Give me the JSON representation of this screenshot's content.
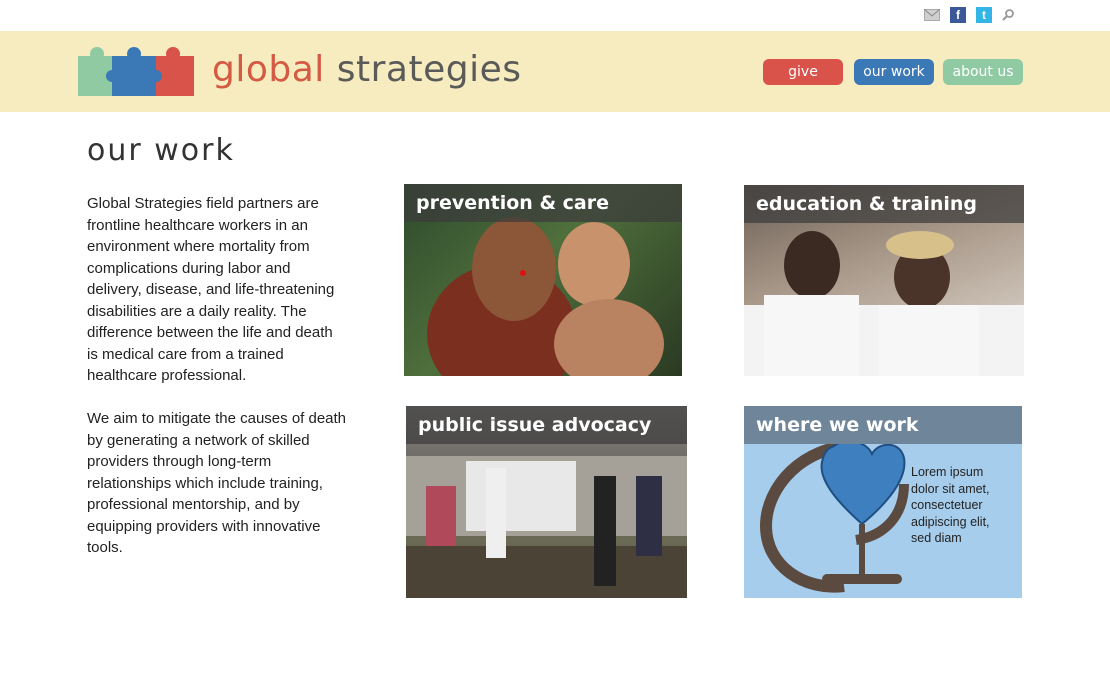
{
  "header": {
    "brand_word1": "global",
    "brand_word2": "strategies",
    "nav": [
      {
        "label": "give",
        "color": "#d9534a"
      },
      {
        "label": "our work",
        "color": "#3b78b6"
      },
      {
        "label": "about us",
        "color": "#8fcaa3"
      }
    ],
    "utility_icons": [
      "mail-icon",
      "facebook-icon",
      "twitter-icon",
      "search-icon"
    ],
    "facebook_glyph": "f",
    "twitter_glyph": "t"
  },
  "main": {
    "title": "our work",
    "paragraphs": [
      "Global Strategies field partners are frontline healthcare workers in an environment where mortality from complications during labor and delivery, disease, and life-threatening disabilities are a daily reality.  The difference between the life and death is medical care from a trained healthcare professional.",
      "We aim to mitigate the causes of death by generating a network of skilled providers through long-term relationships which include training, professional mentorship, and by equipping providers with innovative tools."
    ],
    "cards": [
      {
        "label": "prevention & care"
      },
      {
        "label": "education & training"
      },
      {
        "label": "public issue advocacy"
      },
      {
        "label": "where we work",
        "text": "Lorem ipsum dolor sit amet, consectetuer adipiscing elit, sed diam"
      }
    ]
  },
  "colors": {
    "header_bg": "#f7ecbf",
    "brand_accent": "#d35a43",
    "brand_gray": "#5a5a58",
    "puzzle_green": "#8fcaa3",
    "puzzle_blue": "#3b78b6",
    "puzzle_red": "#d9534a"
  }
}
